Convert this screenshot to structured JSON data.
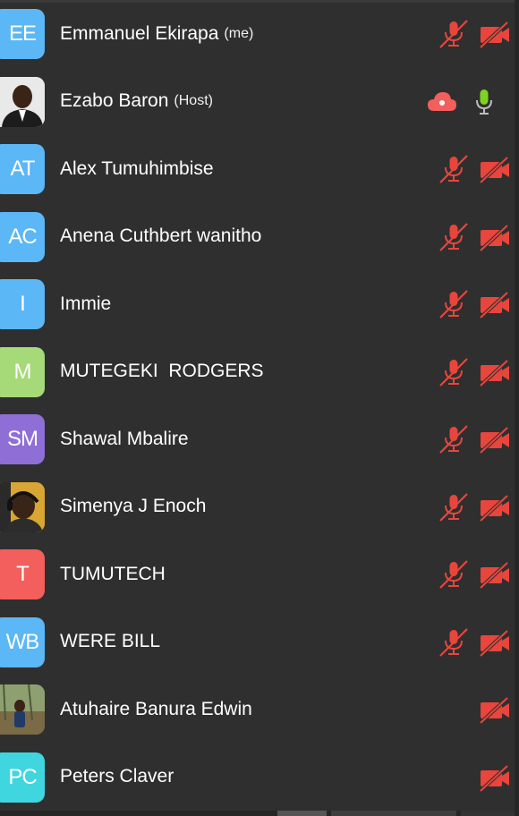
{
  "participants": [
    {
      "initials": "EE",
      "color": "#5bb7f5",
      "name": "Emmanuel Ekirapa",
      "tag": "(me)",
      "mic": "muted",
      "cam": "off"
    },
    {
      "initials": "",
      "photo": true,
      "photo_style": "man-suit",
      "color": "#e8e8e8",
      "name": "Ezabo Baron",
      "tag": "(Host)",
      "mic": "on",
      "cam": "cloud-record"
    },
    {
      "initials": "AT",
      "color": "#5bb7f5",
      "name": "Alex Tumuhimbise",
      "tag": "",
      "mic": "muted",
      "cam": "off"
    },
    {
      "initials": "AC",
      "color": "#5bb7f5",
      "name": "Anena Cuthbert wanitho",
      "tag": "",
      "mic": "muted",
      "cam": "off"
    },
    {
      "initials": "I",
      "color": "#5bb7f5",
      "name": "Immie",
      "tag": "",
      "mic": "muted",
      "cam": "off"
    },
    {
      "initials": "M",
      "color": "#a6d978",
      "name": "MUTEGEKI  RODGERS",
      "tag": "",
      "mic": "muted",
      "cam": "off"
    },
    {
      "initials": "SM",
      "color": "#8f6fd6",
      "name": "Shawal Mbalire",
      "tag": "",
      "mic": "muted",
      "cam": "off"
    },
    {
      "initials": "",
      "photo": true,
      "photo_style": "headset",
      "color": "#e0b347",
      "name": "Simenya J Enoch",
      "tag": "",
      "mic": "muted",
      "cam": "off"
    },
    {
      "initials": "T",
      "color": "#f25f5c",
      "name": "TUMUTECH",
      "tag": "",
      "mic": "muted",
      "cam": "off"
    },
    {
      "initials": "WB",
      "color": "#5bb7f5",
      "name": "WERE BILL",
      "tag": "",
      "mic": "muted",
      "cam": "off"
    },
    {
      "initials": "",
      "photo": true,
      "photo_style": "outdoor",
      "color": "#6b7a55",
      "name": "Atuhaire Banura Edwin",
      "tag": "",
      "mic": "none",
      "cam": "off"
    },
    {
      "initials": "PC",
      "color": "#3fd6e0",
      "name": "Peters Claver",
      "tag": "",
      "mic": "none",
      "cam": "off"
    }
  ],
  "colors": {
    "muted_red": "#e8453c",
    "mic_on_green": "#7ed321",
    "background": "#2f2f2f"
  }
}
